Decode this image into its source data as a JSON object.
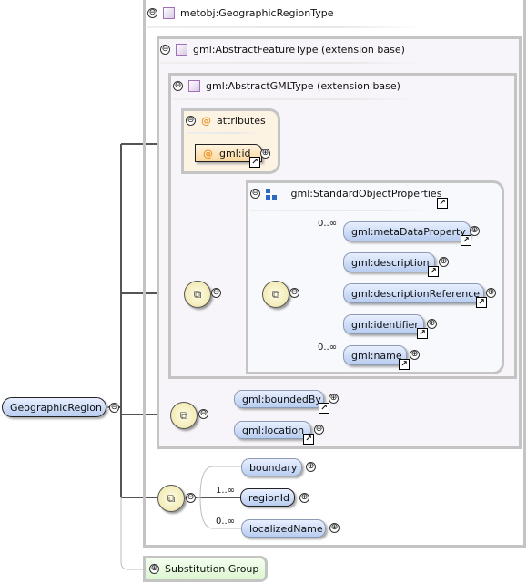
{
  "root": {
    "label": "GeographicRegion"
  },
  "type": {
    "label": "metobj:GeographicRegionType"
  },
  "feature": {
    "label": "gml:AbstractFeatureType (extension base)"
  },
  "gml_type": {
    "label": "gml:AbstractGMLType (extension base)"
  },
  "attributes": {
    "label": "attributes",
    "symbol": "@",
    "items": [
      {
        "label": "gml:id"
      }
    ]
  },
  "group": {
    "label": "gml:StandardObjectProperties",
    "elements": [
      {
        "label": "gml:metaDataProperty",
        "card": "0..∞"
      },
      {
        "label": "gml:description",
        "card": ""
      },
      {
        "label": "gml:descriptionReference",
        "card": ""
      },
      {
        "label": "gml:identifier",
        "card": ""
      },
      {
        "label": "gml:name",
        "card": "0..∞"
      }
    ]
  },
  "feature_elements": [
    {
      "label": "gml:boundedBy"
    },
    {
      "label": "gml:location"
    }
  ],
  "own_elements": [
    {
      "label": "boundary",
      "card": ""
    },
    {
      "label": "regionId",
      "card": "1..∞"
    },
    {
      "label": "localizedName",
      "card": "0..∞"
    }
  ],
  "substitution": {
    "label": "Substitution Group"
  },
  "icons": {
    "collapse": "⊖",
    "expand": "⊕",
    "sequence": "sequence-icon",
    "link": "↗"
  },
  "colors": {
    "element": "#b8cdf0",
    "attribute": "#fde6c0",
    "sequence": "#ede3a0",
    "substitution": "#e4f8dc",
    "type_box": "#f8f5fa"
  }
}
